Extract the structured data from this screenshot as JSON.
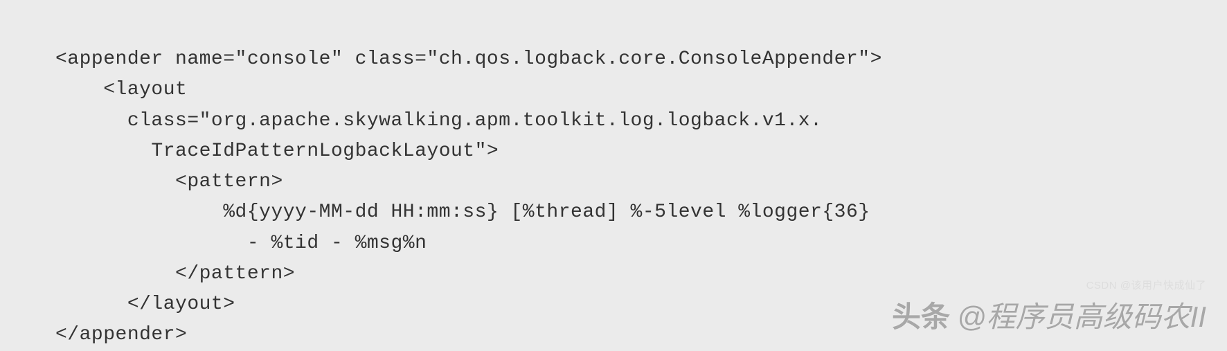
{
  "code": {
    "line1": "<appender name=\"console\" class=\"ch.qos.logback.core.ConsoleAppender\">",
    "line2": "    <layout",
    "line3": "      class=\"org.apache.skywalking.apm.toolkit.log.logback.v1.x.",
    "line4": "        TraceIdPatternLogbackLayout\">",
    "line5": "          <pattern>",
    "line6": "              %d{yyyy-MM-dd HH:mm:ss} [%thread] %-5level %logger{36}",
    "line7": "                - %tid - %msg%n",
    "line8": "          </pattern>",
    "line9": "      </layout>",
    "line10": "</appender>"
  },
  "watermark": {
    "label": "头条",
    "name": "@程序员高级码农II"
  },
  "csdn": "CSDN @该用户快成仙了"
}
